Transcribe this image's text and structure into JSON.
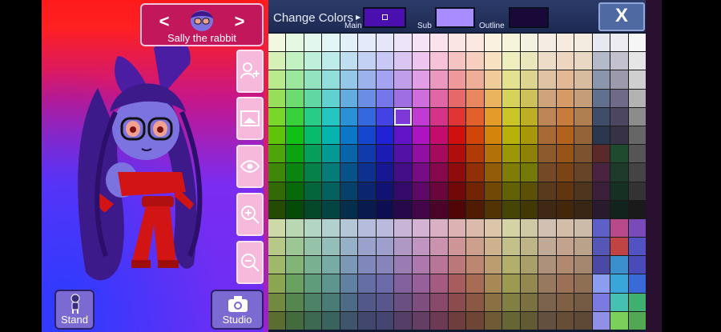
{
  "character": {
    "name": "Sally the rabbit",
    "prev_label": "<",
    "next_label": ">"
  },
  "side_buttons": [
    {
      "name": "add-preset",
      "icon": "person-plus-icon"
    },
    {
      "name": "background",
      "icon": "image-frame-icon"
    },
    {
      "name": "eye-toggle",
      "icon": "eye-icon"
    },
    {
      "name": "zoom-in",
      "icon": "zoom-in-icon"
    },
    {
      "name": "zoom-out",
      "icon": "zoom-out-icon"
    }
  ],
  "bottom": {
    "stand_label": "Stand",
    "studio_label": "Studio"
  },
  "color_panel": {
    "title": "Change Colors",
    "main_label": "Main",
    "sub_label": "Sub",
    "outline_label": "Outline",
    "close_label": "X",
    "main_color": "#4b0fb0",
    "sub_color": "#a98cff",
    "outline_color": "#1a0838"
  },
  "palette": {
    "rows": [
      [
        "#f2f7df",
        "#e5f8e2",
        "#e2f7ee",
        "#e1f6f5",
        "#e2f0f8",
        "#e4eaf9",
        "#e6e6fb",
        "#ede4f9",
        "#f6e4f6",
        "#fae3ec",
        "#fbe4e4",
        "#fbe9e1",
        "#fbf1e1",
        "#f6f5dc",
        "#f3f1df",
        "#f5ede4",
        "#f7eadf",
        "#f4ece1",
        "#e6e9ef",
        "#edecf2",
        "#f6f6f6"
      ],
      [
        "#d6f1b8",
        "#c2f2c1",
        "#bff0db",
        "#bdeceb",
        "#bfdff1",
        "#c3d2f4",
        "#c8c8f7",
        "#dac5f3",
        "#eec5ef",
        "#f5c2d9",
        "#f6c3c3",
        "#f6cfc0",
        "#f7e1c1",
        "#efeebd",
        "#ebe7bd",
        "#ecdcc8",
        "#eed5c0",
        "#e9d8c4",
        "#b3bac9",
        "#c3c1d0",
        "#e5e5e5"
      ],
      [
        "#b9ea8e",
        "#9be79c",
        "#93e3c0",
        "#91dedd",
        "#95c7e8",
        "#9bb2ec",
        "#a3a3f1",
        "#c09eea",
        "#e19de6",
        "#eb98c1",
        "#ee9a9a",
        "#efae97",
        "#f0cc98",
        "#e4e290",
        "#ddd58f",
        "#dfc3a4",
        "#e2b994",
        "#d8bc9f",
        "#8b96ad",
        "#9c99ad",
        "#cfcfcf"
      ],
      [
        "#97df5a",
        "#6ddc6f",
        "#61d8a4",
        "#5fd1cf",
        "#63acdf",
        "#6b8ee4",
        "#7676eb",
        "#9f6ee0",
        "#d06ddc",
        "#e166a6",
        "#e76868",
        "#e9885f",
        "#eab35e",
        "#d7d35a",
        "#cdc25a",
        "#cfa47c",
        "#d59a66",
        "#c59d78",
        "#62708f",
        "#6f6a88",
        "#b3b3b3"
      ],
      [
        "#78d728",
        "#37d23a",
        "#27cd86",
        "#25c6c2",
        "#2a91d7",
        "#3568dd",
        "#4343e5",
        "#7e38d7",
        "#c03ad3",
        "#d5328a",
        "#df3535",
        "#e2602c",
        "#e49b2a",
        "#cbc526",
        "#bdae26",
        "#bd8656",
        "#c77c3c",
        "#b07f50",
        "#3f4c6a",
        "#4c4660",
        "#8c8c8c"
      ],
      [
        "#5fc30a",
        "#10c014",
        "#08bb6c",
        "#07b3ae",
        "#0b78c7",
        "#1446ce",
        "#2121d6",
        "#6214c6",
        "#ae13c1",
        "#c40c6e",
        "#d00f0f",
        "#d1440a",
        "#d3850b",
        "#b8b208",
        "#a89808",
        "#a76a37",
        "#b2621d",
        "#946338",
        "#2b364f",
        "#383247",
        "#666666"
      ],
      [
        "#4da509",
        "#0ca311",
        "#079e5b",
        "#069893",
        "#0965a9",
        "#113bad",
        "#1c1cb5",
        "#5311a6",
        "#920fa3",
        "#a50a5d",
        "#b00d0d",
        "#b13a08",
        "#b3710a",
        "#9c9707",
        "#8f8107",
        "#8d5a2e",
        "#975418",
        "#7d532f",
        "#5a2a2a",
        "#1e4a2e",
        "#555555"
      ],
      [
        "#3f8708",
        "#0a860e",
        "#06814a",
        "#057c78",
        "#075389",
        "#0e308e",
        "#171794",
        "#440e88",
        "#780c85",
        "#87084c",
        "#900b0b",
        "#912f06",
        "#925c08",
        "#807c06",
        "#757a06",
        "#734a25",
        "#7b4414",
        "#674427",
        "#4a2340",
        "#1c3b2a",
        "#444444"
      ],
      [
        "#316a06",
        "#08690b",
        "#05653a",
        "#04615e",
        "#06416b",
        "#0b266f",
        "#121274",
        "#350b6a",
        "#5e0968",
        "#6a063b",
        "#710909",
        "#722505",
        "#724806",
        "#646104",
        "#5c5004",
        "#5a3a1d",
        "#60350f",
        "#50351e",
        "#3c1f3a",
        "#173024",
        "#333333"
      ],
      [
        "#234b04",
        "#054b08",
        "#034829",
        "#034543",
        "#042e4c",
        "#081b4f",
        "#0d0d52",
        "#26084b",
        "#43064a",
        "#4b042a",
        "#500606",
        "#511a03",
        "#513304",
        "#474503",
        "#413903",
        "#402914",
        "#44260b",
        "#392615",
        "#2a1a2e",
        "#12221c",
        "#1a1a1a"
      ],
      [
        "#ced9a8",
        "#b8d7b2",
        "#b2d5c4",
        "#b1d1cf",
        "#b3c7d8",
        "#b6bcdb",
        "#babadd",
        "#c7b4d7",
        "#d4b2d4",
        "#dab0c4",
        "#dcb2b2",
        "#dcbaab",
        "#dcc6aa",
        "#d5d3a6",
        "#d0c9a5",
        "#d2c0b2",
        "#d4bcaa",
        "#cdbba9",
        "#5f5fc8",
        "#b84a8a",
        "#7a4ab8"
      ],
      [
        "#b7c987",
        "#9cc693",
        "#94c3aa",
        "#93beb9",
        "#96b0c8",
        "#9aa2cc",
        "#9f9fce",
        "#b098c5",
        "#c195c1",
        "#ca92ae",
        "#cd9595",
        "#cda08e",
        "#cdb28d",
        "#c3c189",
        "#bdb487",
        "#c0a996",
        "#c3a38d",
        "#b9a18a",
        "#5656b8",
        "#c04444",
        "#5252c2"
      ],
      [
        "#a0b86a",
        "#82b478",
        "#79b092",
        "#77aba5",
        "#7b98b6",
        "#8087ba",
        "#8585bc",
        "#9a7cb2",
        "#ad79ad",
        "#b87597",
        "#bb7878",
        "#bc8670",
        "#bc9d6f",
        "#b1af6b",
        "#a99f69",
        "#ad917a",
        "#b1896f",
        "#a4876d",
        "#4a4aa5",
        "#3a8fcc",
        "#4a4ab8"
      ],
      [
        "#8aa650",
        "#69a160",
        "#5f9c7c",
        "#5c968f",
        "#6081a2",
        "#666ea6",
        "#6b6ba9",
        "#82619e",
        "#98609a",
        "#a45a81",
        "#a75d5d",
        "#a86c55",
        "#a88854",
        "#9c9a51",
        "#938950",
        "#977960",
        "#9b7054",
        "#8e6f53",
        "#8c9cf0",
        "#3aa5d8",
        "#3a6ad8"
      ],
      [
        "#718a3f",
        "#55864d",
        "#4c8265",
        "#4a7c76",
        "#4d6a87",
        "#52598a",
        "#57578d",
        "#6a4f82",
        "#7e4e7e",
        "#88496a",
        "#8a4c4c",
        "#8b5844",
        "#8b7044",
        "#817f41",
        "#797140",
        "#7c634e",
        "#806044",
        "#755b44",
        "#7a7ae0",
        "#46c0b0",
        "#40b070"
      ],
      [
        "#5a6e32",
        "#446b3d",
        "#3d6851",
        "#3b635e",
        "#3e556c",
        "#42476e",
        "#454571",
        "#553f68",
        "#653e65",
        "#6d3a55",
        "#6e3d3d",
        "#6f4636",
        "#6f5a36",
        "#676533",
        "#615a33",
        "#63503e",
        "#664d36",
        "#5e4936",
        "#9090e8",
        "#7ad05a",
        "#52a852"
      ]
    ],
    "selected": "4.7"
  }
}
